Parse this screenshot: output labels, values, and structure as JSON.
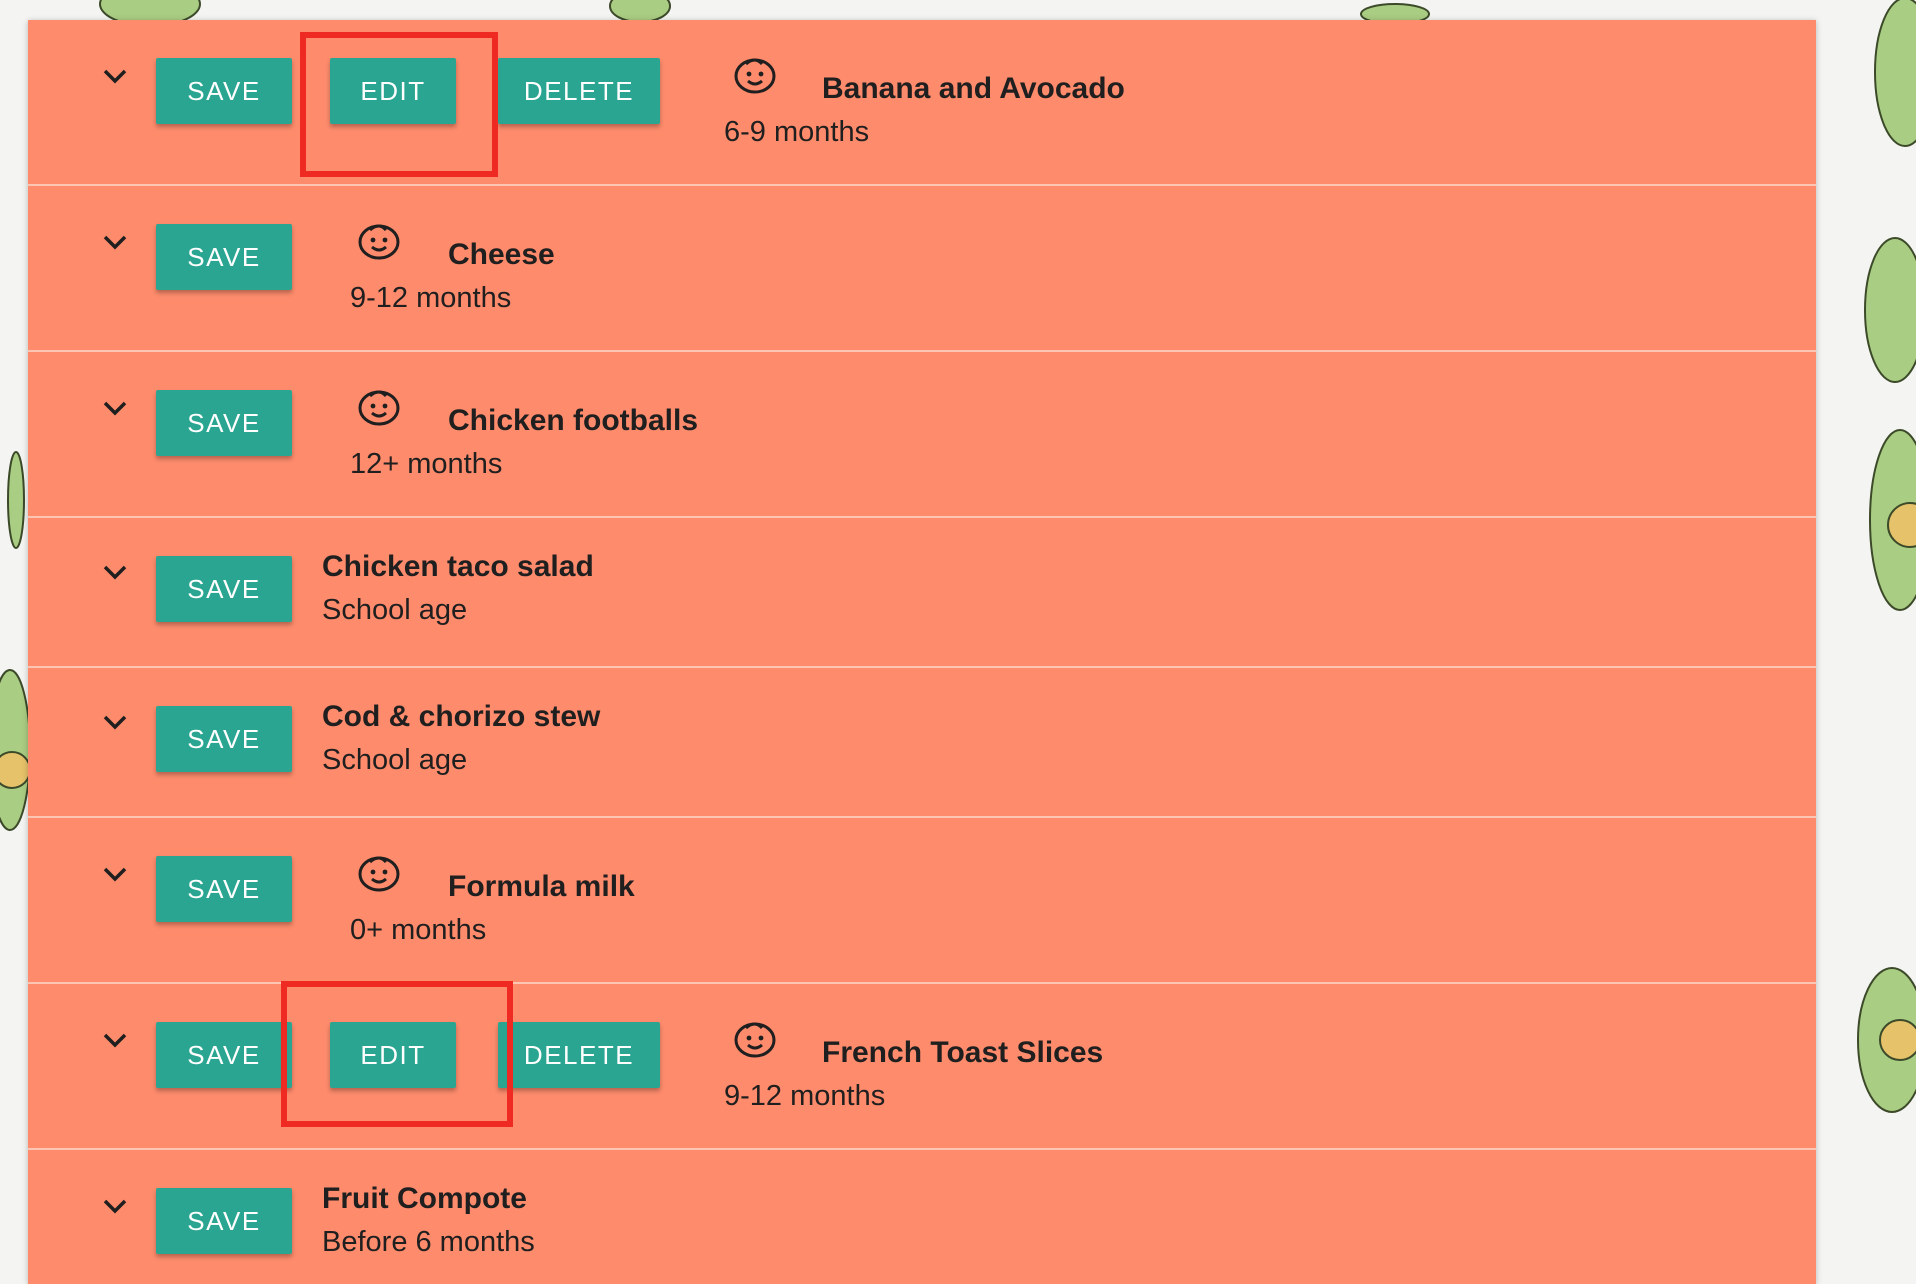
{
  "colors": {
    "panel_bg": "#fd8b6c",
    "button_bg": "#2aa591",
    "button_text": "#ffffff",
    "divider": "#fcc5b4",
    "highlight": "#ee2a22",
    "text": "#1f1f1f"
  },
  "icons": {
    "expand": "chevron-down-icon",
    "age_badge": "baby-face-icon"
  },
  "foods": [
    {
      "title": "Banana and Avocado",
      "age": "6-9 months",
      "buttons": {
        "save": "SAVE",
        "edit": "EDIT",
        "delete": "DELETE"
      }
    },
    {
      "title": "Cheese",
      "age": "9-12 months",
      "buttons": {
        "save": "SAVE"
      }
    },
    {
      "title": "Chicken footballs",
      "age": "12+ months",
      "buttons": {
        "save": "SAVE"
      }
    },
    {
      "title": "Chicken taco salad",
      "age": "School age",
      "buttons": {
        "save": "SAVE"
      }
    },
    {
      "title": "Cod & chorizo stew",
      "age": "School age",
      "buttons": {
        "save": "SAVE"
      }
    },
    {
      "title": "Formula milk",
      "age": "0+ months",
      "buttons": {
        "save": "SAVE"
      }
    },
    {
      "title": "French Toast Slices",
      "age": "9-12 months",
      "buttons": {
        "save": "SAVE",
        "edit": "EDIT",
        "delete": "DELETE"
      }
    },
    {
      "title": "Fruit Compote",
      "age": "Before 6 months",
      "buttons": {
        "save": "SAVE"
      }
    }
  ]
}
